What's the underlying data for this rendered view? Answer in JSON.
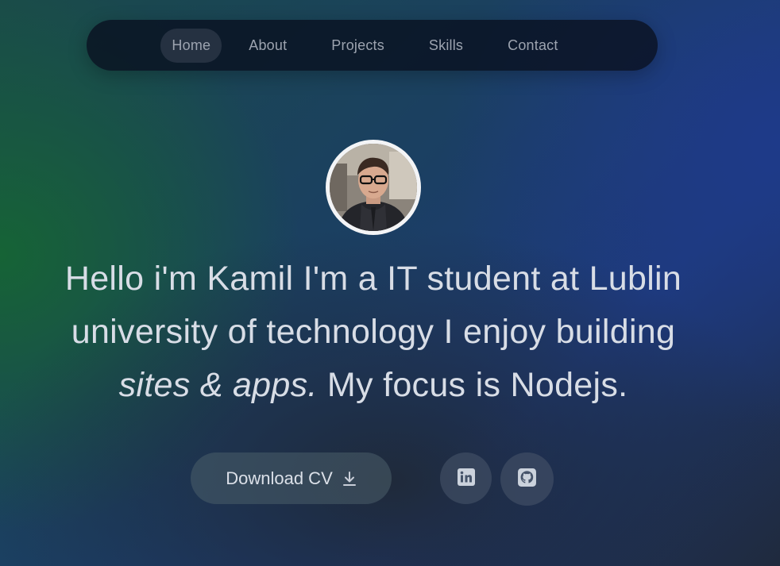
{
  "nav": {
    "items": [
      {
        "label": "Home",
        "active": true
      },
      {
        "label": "About",
        "active": false
      },
      {
        "label": "Projects",
        "active": false
      },
      {
        "label": "Skills",
        "active": false
      },
      {
        "label": "Contact",
        "active": false
      }
    ]
  },
  "hero": {
    "avatar_icon": "profile-photo",
    "line1": "Hello i'm Kamil I'm a IT student at Lublin",
    "line2": "university of technology I enjoy building",
    "line3_italic": "sites & apps.",
    "line3_rest": " My focus is Nodejs."
  },
  "actions": {
    "download_cv_label": "Download CV",
    "download_icon": "download-icon",
    "linkedin_icon": "linkedin-icon",
    "github_icon": "github-icon"
  },
  "colors": {
    "nav_background": "#0a1121",
    "text": "#d8dde6",
    "nav_text": "#9ca3af",
    "accent_green": "#166534",
    "accent_blue": "#1e3a8a"
  }
}
